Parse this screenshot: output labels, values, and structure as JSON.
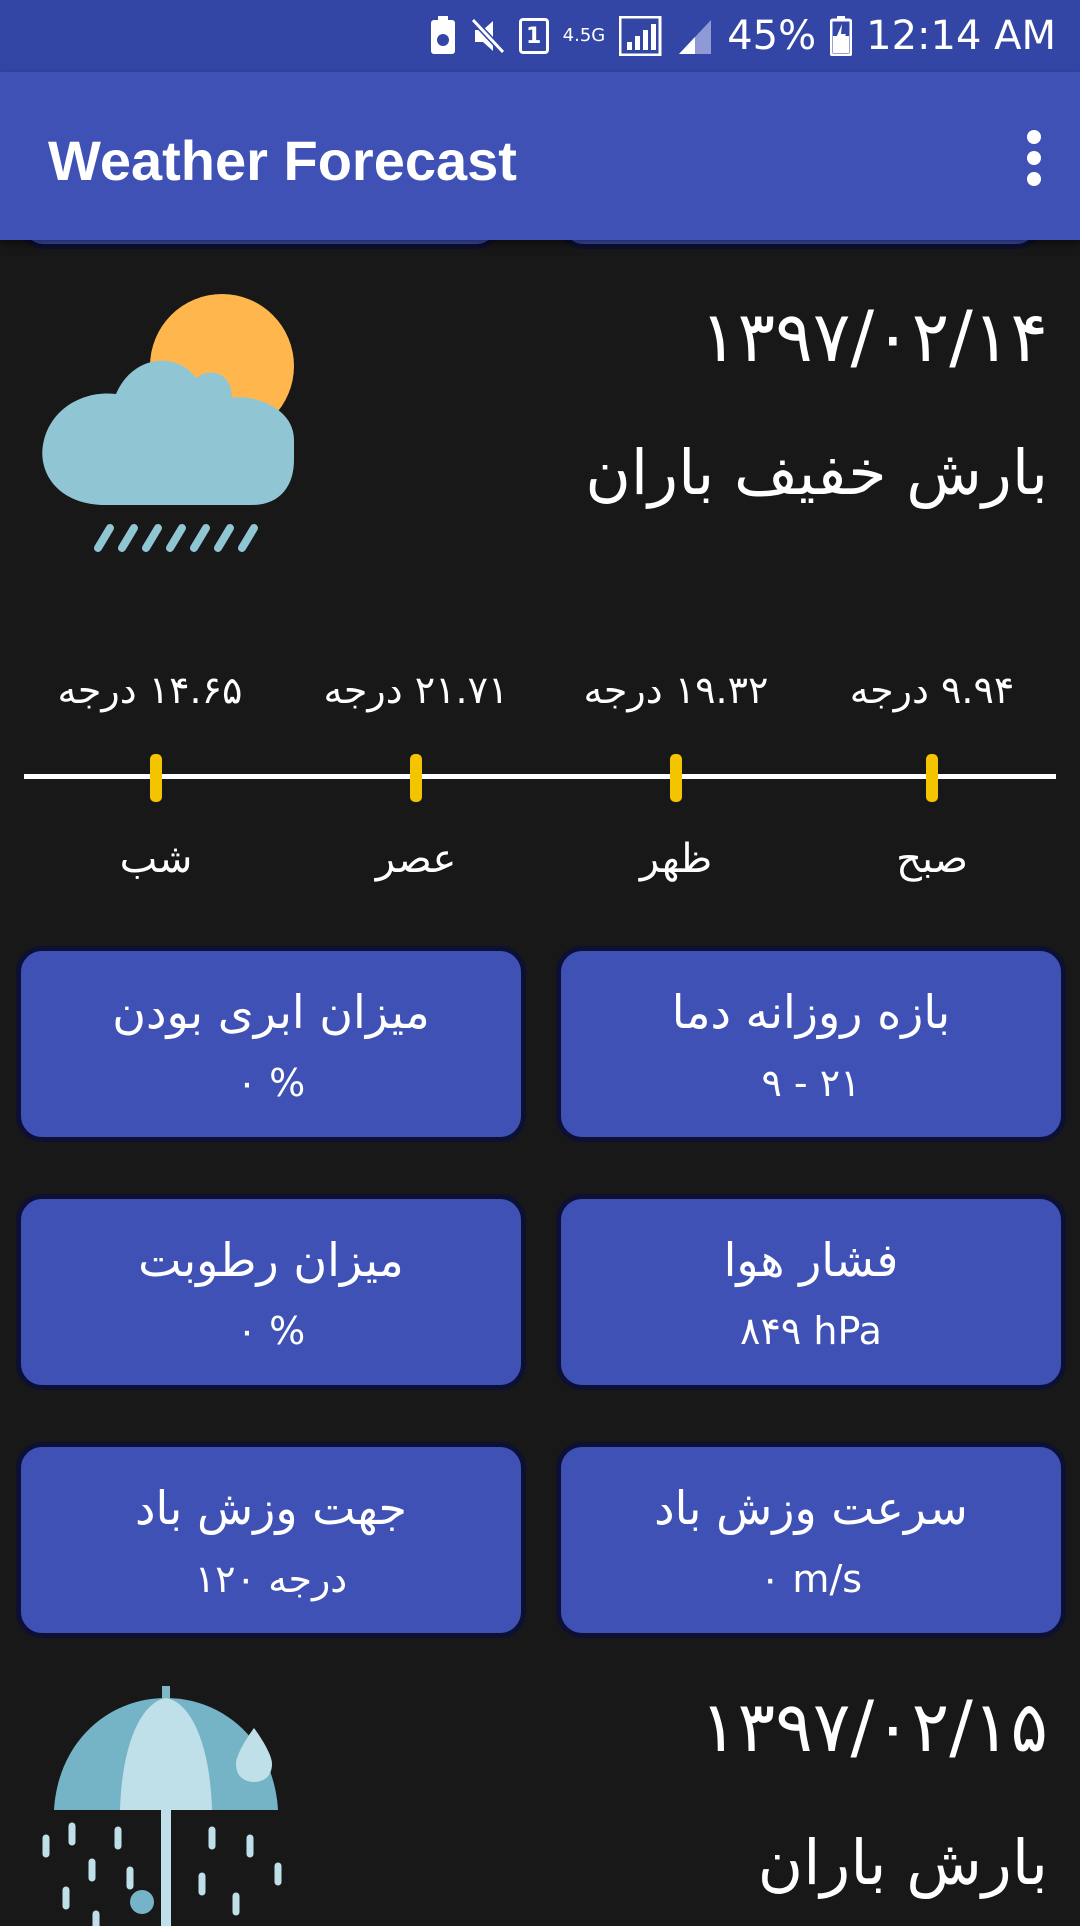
{
  "status_bar": {
    "sim_label": "1",
    "network_label": "4.5G",
    "battery": "45%",
    "time": "12:14 AM"
  },
  "app_bar": {
    "title": "Weather Forecast",
    "menu_icon": "more-vert-icon"
  },
  "days": [
    {
      "date": "۱۳۹۷/۰۲/۱۴",
      "condition": "بارش خفیف باران",
      "icon": "sun-cloud-rain-icon",
      "temps": [
        {
          "period": "صبح",
          "temp": "۹.۹۴ درجه"
        },
        {
          "period": "ظهر",
          "temp": "۱۹.۳۲ درجه"
        },
        {
          "period": "عصر",
          "temp": "۲۱.۷۱ درجه"
        },
        {
          "period": "شب",
          "temp": "۱۴.۶۵ درجه"
        }
      ],
      "cards": [
        {
          "title": "بازه روزانه دما",
          "value": "۹ - ۲۱"
        },
        {
          "title": "میزان ابری بودن",
          "value": "۰ %"
        },
        {
          "title": "فشار هوا",
          "value": "۸۴۹ hPa"
        },
        {
          "title": "میزان رطوبت",
          "value": "۰ %"
        },
        {
          "title": "سرعت وزش باد",
          "value": "۰ m/s"
        },
        {
          "title": "جهت وزش باد",
          "value": "۱۲۰ درجه"
        }
      ]
    },
    {
      "date": "۱۳۹۷/۰۲/۱۵",
      "condition": "بارش باران",
      "icon": "umbrella-rain-icon"
    }
  ],
  "colors": {
    "status_bar": "#3346a6",
    "app_bar": "#3f51b5",
    "background": "#181818",
    "card": "#3f51b5",
    "tick": "#f5c400",
    "sun": "#ffb74d",
    "cloud": "#90c6d4"
  }
}
